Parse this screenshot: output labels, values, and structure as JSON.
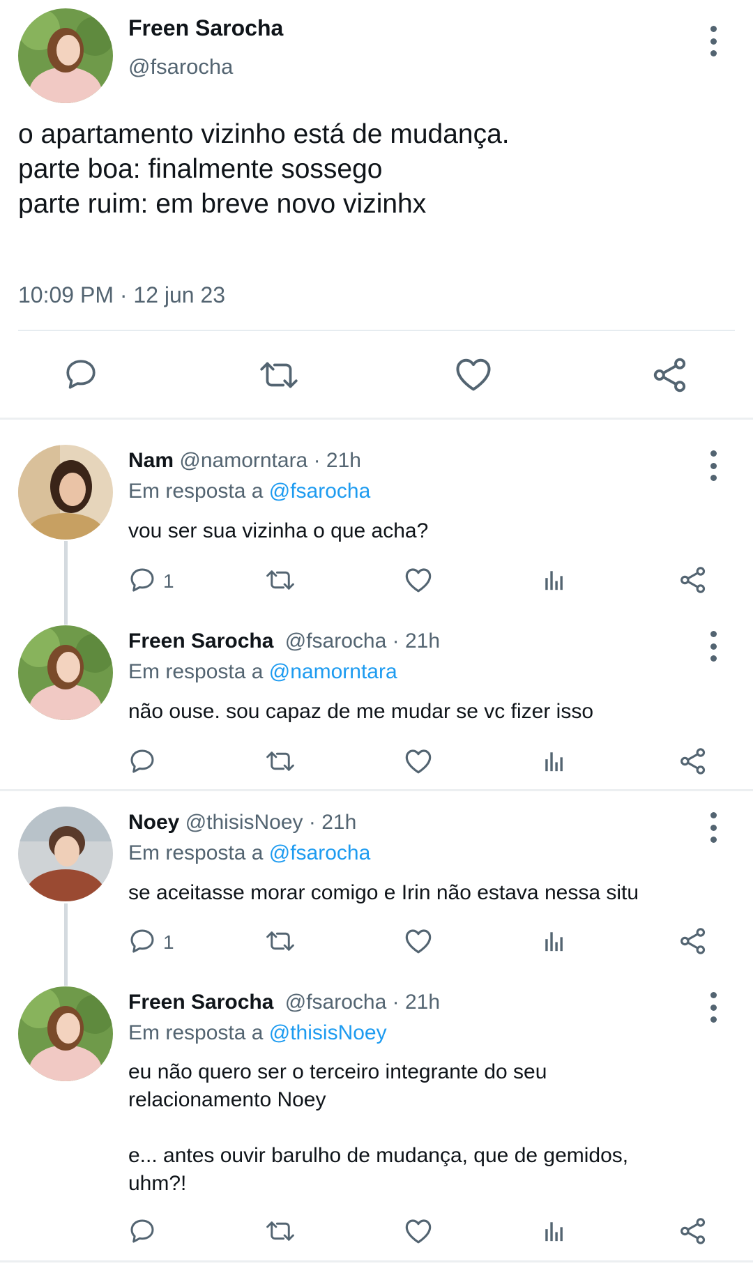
{
  "main_tweet": {
    "name": "Freen Sarocha",
    "handle": "@fsarocha",
    "text_line1": "o apartamento vizinho está de mudança.",
    "text_line2": "parte boa: finalmente sossego",
    "text_line3": "parte ruim: em breve novo vizinhx",
    "timestamp": "10:09 PM · 12 jun 23",
    "actions": {
      "reply_icon": "reply-icon",
      "retweet_icon": "retweet-icon",
      "like_icon": "heart-icon",
      "share_icon": "share-icon"
    }
  },
  "replies": [
    {
      "name": "Nam",
      "handle": "@namorntara",
      "time": "· 21h",
      "in_reply_prefix": "Em resposta a",
      "in_reply_to": "@fsarocha",
      "text": "vou ser sua vizinha o que acha?",
      "reply_count": "1"
    },
    {
      "name": "Freen Sarocha",
      "handle": "@fsarocha",
      "time": "· 21h",
      "in_reply_prefix": "Em resposta a",
      "in_reply_to": "@namorntara",
      "text": "não ouse. sou capaz de me mudar se vc fizer isso",
      "reply_count": ""
    },
    {
      "name": "Noey",
      "handle": "@thisisNoey",
      "time": "· 21h",
      "in_reply_prefix": "Em resposta a",
      "in_reply_to": "@fsarocha",
      "text": "se aceitasse morar comigo e Irin não estava nessa situ",
      "reply_count": "1"
    },
    {
      "name": "Freen Sarocha",
      "handle": "@fsarocha",
      "time": "· 21h",
      "in_reply_prefix": "Em resposta a",
      "in_reply_to": "@thisisNoey",
      "text": "eu não quero ser o terceiro integrante do seu\nrelacionamento Noey\n\ne... antes ouvir barulho de mudança, que de gemidos,\nuhm?!",
      "reply_count": ""
    }
  ],
  "colors": {
    "text": "#0f1419",
    "secondary": "#536471",
    "link": "#1d9bf0",
    "divider": "#eceff1"
  }
}
